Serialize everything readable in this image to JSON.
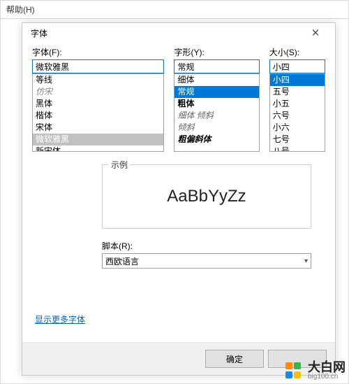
{
  "menu": {
    "help": "帮助(H)"
  },
  "dialog": {
    "title": "字体",
    "columns": {
      "font": {
        "label": "字体(F):",
        "value": "微软雅黑",
        "items": [
          {
            "text": "等线",
            "cls": ""
          },
          {
            "text": "仿宋",
            "cls": "gray"
          },
          {
            "text": "黑体",
            "cls": ""
          },
          {
            "text": "楷体",
            "cls": ""
          },
          {
            "text": "宋体",
            "cls": ""
          },
          {
            "text": "微软雅黑",
            "cls": "selgray"
          },
          {
            "text": "新宋体",
            "cls": ""
          }
        ]
      },
      "style": {
        "label": "字形(Y):",
        "value": "常规",
        "items": [
          {
            "text": "细体",
            "cls": ""
          },
          {
            "text": "常规",
            "cls": "sel"
          },
          {
            "text": "粗体",
            "cls": "st-bold"
          },
          {
            "text": "细体 倾斜",
            "cls": "st-ital"
          },
          {
            "text": "倾斜",
            "cls": "st-ital"
          },
          {
            "text": "粗偏斜体",
            "cls": "st-boldital"
          }
        ]
      },
      "size": {
        "label": "大小(S):",
        "value": "小四",
        "items": [
          {
            "text": "小四",
            "cls": "sel"
          },
          {
            "text": "五号",
            "cls": ""
          },
          {
            "text": "小五",
            "cls": ""
          },
          {
            "text": "六号",
            "cls": ""
          },
          {
            "text": "小六",
            "cls": ""
          },
          {
            "text": "七号",
            "cls": ""
          },
          {
            "text": "八号",
            "cls": ""
          }
        ]
      }
    },
    "sample": {
      "legend": "示例",
      "text": "AaBbYyZz"
    },
    "script": {
      "label": "脚本(R):",
      "value": "西欧语言"
    },
    "more_fonts": "显示更多字体",
    "ok": "确定",
    "cancel": ""
  },
  "watermark": {
    "brand": "大白网",
    "url": "big100.cn"
  }
}
